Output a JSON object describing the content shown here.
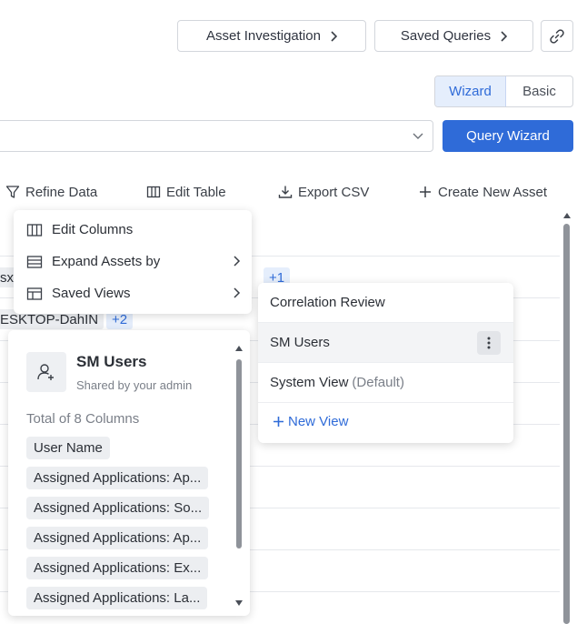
{
  "header": {
    "asset_investigation": "Asset Investigation",
    "saved_queries": "Saved Queries"
  },
  "mode_toggle": {
    "wizard": "Wizard",
    "basic": "Basic"
  },
  "query": {
    "wizard_button": "Query Wizard"
  },
  "toolbar": {
    "refine_data": "Refine Data",
    "edit_table": "Edit Table",
    "export_csv": "Export CSV",
    "create_new_asset": "Create New Asset"
  },
  "background": {
    "row1_prefix": "sx-",
    "row1_tag": "+1",
    "row2_hostname": "ESKTOP-DahIN",
    "row2_tag": "+2"
  },
  "refine_menu": {
    "items": [
      {
        "label": "Edit Columns",
        "icon": "columns-icon"
      },
      {
        "label": "Expand Assets by",
        "icon": "list-icon"
      },
      {
        "label": "Saved Views",
        "icon": "layout-icon"
      }
    ]
  },
  "saved_views": {
    "items": [
      {
        "label": "Correlation Review"
      },
      {
        "label": "SM Users"
      },
      {
        "label": "System View",
        "suffix": "(Default)"
      }
    ],
    "new_view": "New View"
  },
  "view_preview": {
    "title": "SM Users",
    "subtitle": "Shared by your admin",
    "total": "Total of 8 Columns",
    "columns": [
      "User Name",
      "Assigned Applications: Ap...",
      "Assigned Applications: So...",
      "Assigned Applications: Ap...",
      "Assigned Applications: Ex...",
      "Assigned Applications: La..."
    ]
  },
  "colors": {
    "accent": "#2f6bd8",
    "accent_bg": "#e5eefc"
  }
}
